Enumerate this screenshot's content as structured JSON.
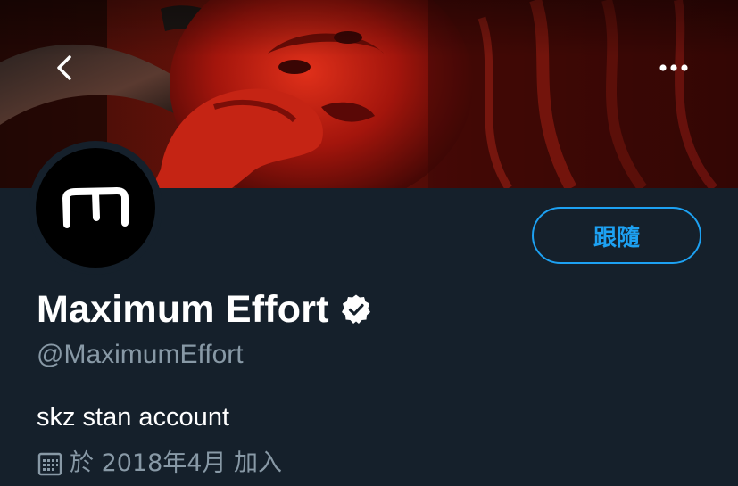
{
  "navigation": {
    "back_icon": "chevron-left-icon",
    "more_icon": "more-horizontal-icon"
  },
  "banner": {
    "description_icon": "header-photo"
  },
  "avatar": {
    "letter": "m"
  },
  "profile": {
    "display_name": "Maximum Effort",
    "verified_icon": "verified-badge-icon",
    "handle": "@MaximumEffort",
    "bio": "skz stan account",
    "joined_text": "於 2018年4月 加入"
  },
  "actions": {
    "follow_label": "跟隨"
  },
  "colors": {
    "background": "#15202b",
    "accent": "#1da1f2",
    "secondary_text": "#8899a6",
    "primary_text": "#ffffff"
  }
}
